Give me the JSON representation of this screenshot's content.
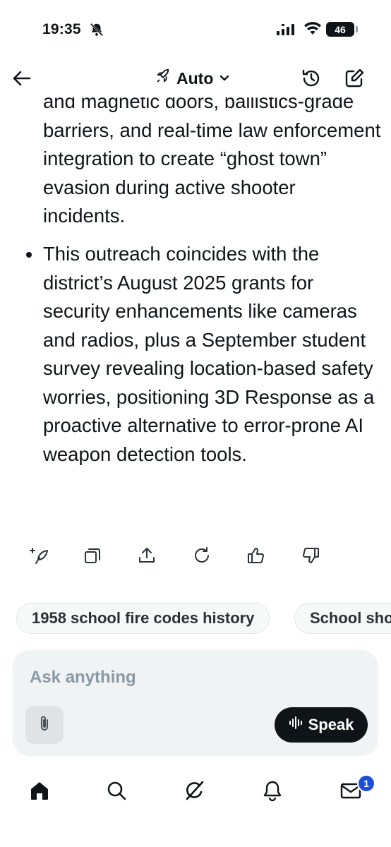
{
  "status_bar": {
    "time": "19:35",
    "battery": "46"
  },
  "header": {
    "model_label": "Auto"
  },
  "content": {
    "paragraph_1": "and magnetic doors, ballistics-grade barriers, and real-time law enforcement integration to create “ghost town” evasion during active shooter incidents.",
    "bullet_2": "This outreach coincides with the district’s August 2025 grants for security enhancements like cameras and radios, plus a September student survey revealing location-based safety worries, positioning 3D Response as a proactive alternative to error-prone AI weapon detection tools."
  },
  "actions": [
    "regenerate-sparkle-icon",
    "copy-icon",
    "share-icon",
    "refresh-icon",
    "thumbs-up-icon",
    "thumbs-down-icon"
  ],
  "suggestions": [
    "1958 school fire codes history",
    "School shooting"
  ],
  "composer": {
    "placeholder": "Ask anything",
    "speak_label": "Speak"
  },
  "nav": {
    "items": [
      "home-icon",
      "search-icon",
      "grok-icon",
      "notifications-icon",
      "messages-icon"
    ],
    "messages_badge": "1"
  }
}
